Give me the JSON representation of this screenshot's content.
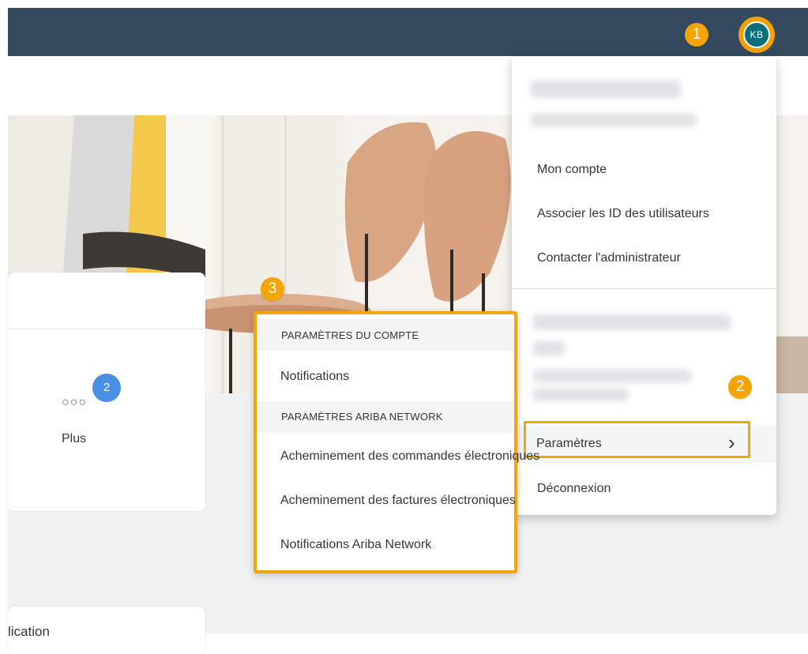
{
  "shell": {
    "avatar_initials": "KB",
    "colors": {
      "shellbar": "#354a5f",
      "callout": "#f5a400",
      "avatar": "#0a6f7a"
    }
  },
  "steps": {
    "one": "1",
    "two": "2",
    "three": "3"
  },
  "tiles": {
    "more_badge_count": "2",
    "more_icon": "more-dots-icon",
    "more_label": "Plus",
    "bottom_card_partial": "lication"
  },
  "user_menu": {
    "items": [
      {
        "label": "Mon compte"
      },
      {
        "label": "Associer les ID des utilisateurs"
      },
      {
        "label": "Contacter l'administrateur"
      }
    ],
    "settings_label": "Paramètres",
    "settings_chevron": "›",
    "logout_label": "Déconnexion"
  },
  "settings_submenu": {
    "account_header": "PARAMÈTRES DU COMPTE",
    "account_items": [
      {
        "label": "Notifications"
      }
    ],
    "network_header": "PARAMÈTRES ARIBA NETWORK",
    "network_items": [
      {
        "label": "Acheminement des commandes électroniques"
      },
      {
        "label": "Acheminement des factures électroniques"
      },
      {
        "label": "Notifications Ariba Network"
      }
    ]
  }
}
